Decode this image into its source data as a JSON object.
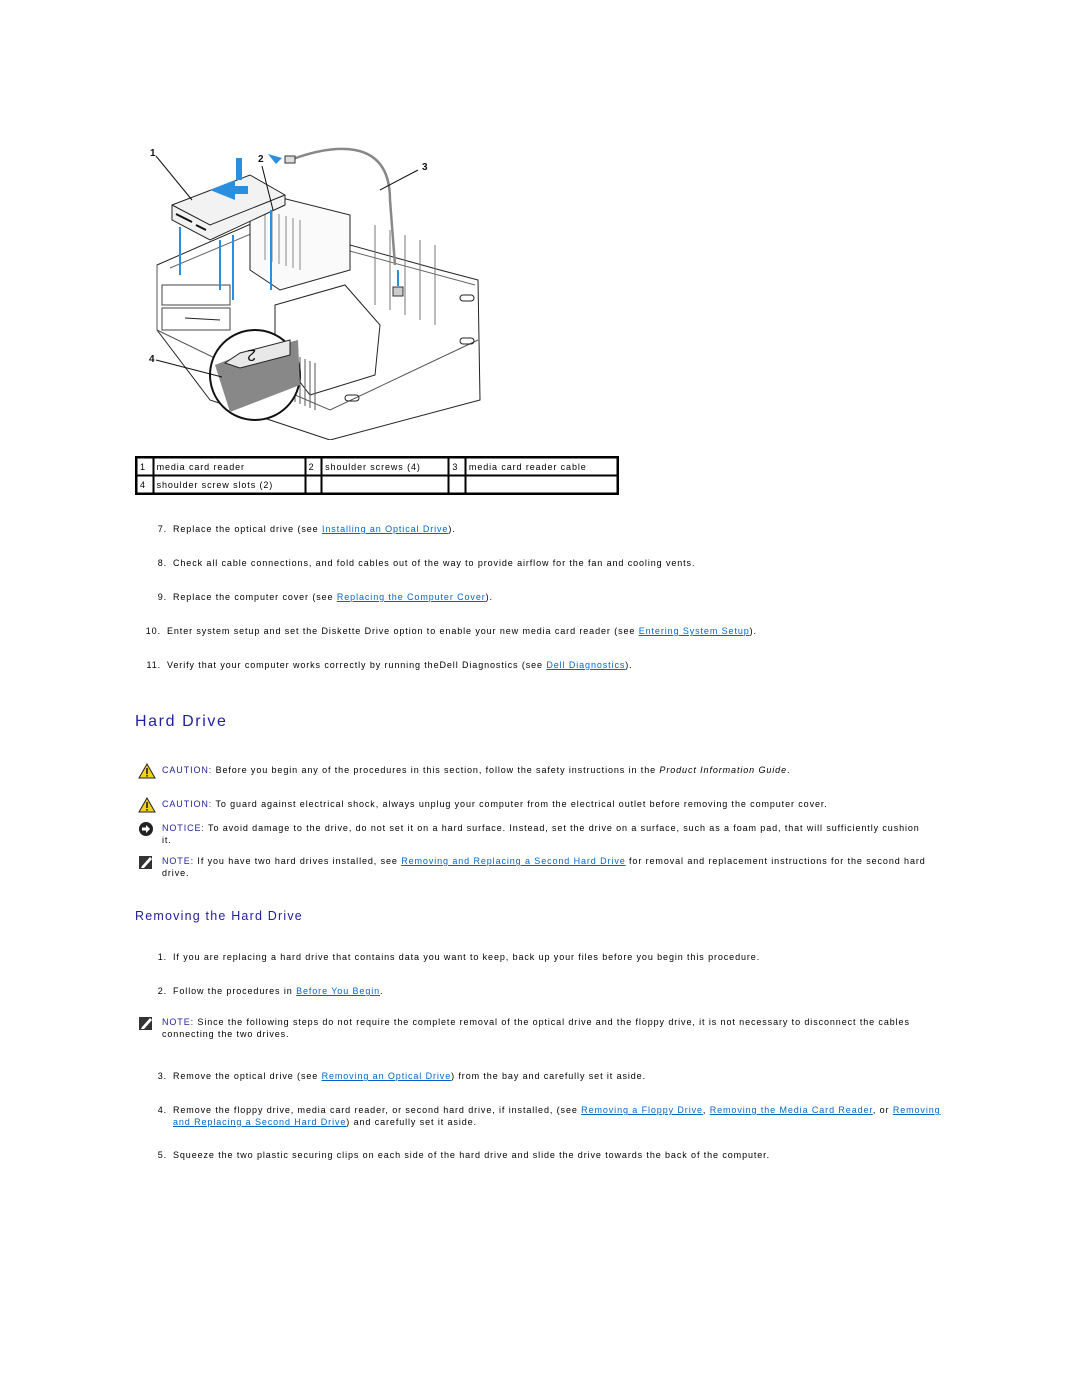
{
  "figure": {
    "description": "Installing a media card reader into a small form factor computer chassis",
    "callout_numbers": [
      "1",
      "2",
      "3",
      "4"
    ],
    "inset_mark": "2"
  },
  "callout_table": {
    "rows": [
      [
        {
          "num": "1",
          "label": "media card reader"
        },
        {
          "num": "2",
          "label": "shoulder screws (4)"
        },
        {
          "num": "3",
          "label": "media card reader cable"
        }
      ],
      [
        {
          "num": "4",
          "label": "shoulder screw slots (2)"
        },
        {
          "num": "",
          "label": ""
        },
        {
          "num": "",
          "label": ""
        }
      ]
    ]
  },
  "steps_top": [
    {
      "num": "7.",
      "before": "Replace the optical drive (see ",
      "link": "Installing an Optical Drive",
      "after": ")."
    },
    {
      "num": "8.",
      "before": "Check all cable connections, and fold cables out of the way to provide airflow for the fan and cooling vents.",
      "link": "",
      "after": ""
    },
    {
      "num": "9.",
      "before": "Replace the computer cover (see ",
      "link": "Replacing the Computer Cover",
      "after": ")."
    },
    {
      "num": "10.",
      "before": "Enter system setup and set the Diskette Drive option to enable your new media card reader (see ",
      "link": "Entering System Setup",
      "after": ")."
    },
    {
      "num": "11.",
      "before": "Verify that your computer works correctly by running theDell Diagnostics (see ",
      "link": "Dell Diagnostics",
      "after": ")."
    }
  ],
  "section_title": "Hard Drive",
  "callouts": [
    {
      "type": "caution",
      "icon": "warning-triangle-icon",
      "label": "CAUTION:",
      "text": " Before you begin any of the procedures in this section, follow the safety instructions in the ",
      "italic": "Product Information Guide",
      "after": "."
    },
    {
      "type": "caution",
      "icon": "warning-triangle-icon",
      "label": "CAUTION:",
      "text": " To guard against electrical shock, always unplug your computer from the electrical outlet before removing the computer cover.",
      "italic": "",
      "after": ""
    },
    {
      "type": "notice",
      "icon": "notice-arrow-icon",
      "label": "NOTICE:",
      "text": " To avoid damage to the drive, do not set it on a hard surface. Instead, set the drive on a surface, such as a foam pad, that will sufficiently cushion it.",
      "italic": "",
      "after": ""
    },
    {
      "type": "note",
      "icon": "note-pencil-icon",
      "label": "NOTE:",
      "text": " If you have two hard drives installed, see ",
      "link": "Removing and Replacing a Second Hard Drive",
      "after": " for removal and replacement instructions for the second hard drive."
    }
  ],
  "subsection_title": "Removing the Hard Drive",
  "steps_bottom": [
    {
      "num": "1.",
      "before": "If you are replacing a hard drive that contains data you want to keep, back up your files before you begin this procedure.",
      "link": "",
      "after": ""
    },
    {
      "num": "2.",
      "before": "Follow the procedures in ",
      "link": "Before You Begin",
      "after": "."
    }
  ],
  "note_bottom": {
    "icon": "note-pencil-icon",
    "label": "NOTE:",
    "text": " Since the following steps do not require the complete removal of the optical drive and the floppy drive, it is not necessary to disconnect the cables connecting the two drives."
  },
  "steps_bottom2": [
    {
      "num": "3.",
      "before": "Remove the optical drive (see ",
      "link": "Removing an Optical Drive",
      "after": ") from the bay and carefully set it aside."
    },
    {
      "num": "4.",
      "before": "Remove the floppy drive, media card reader, or second hard drive, if installed, (see ",
      "links": [
        "Removing a Floppy Drive",
        "Removing the Media Card Reader",
        "Removing and Replacing a Second Hard Drive"
      ],
      "sep1": ", ",
      "sep2": ", or ",
      "after": ") and carefully set it aside."
    },
    {
      "num": "5.",
      "before": "Squeeze the two plastic securing clips on each side of the hard drive and slide the drive towards the back of the computer.",
      "link": "",
      "after": ""
    }
  ],
  "colors": {
    "link": "#0066cc",
    "heading": "#1f1fa0",
    "label": "#1f1fa0",
    "arrow": "#2b8fe0"
  }
}
